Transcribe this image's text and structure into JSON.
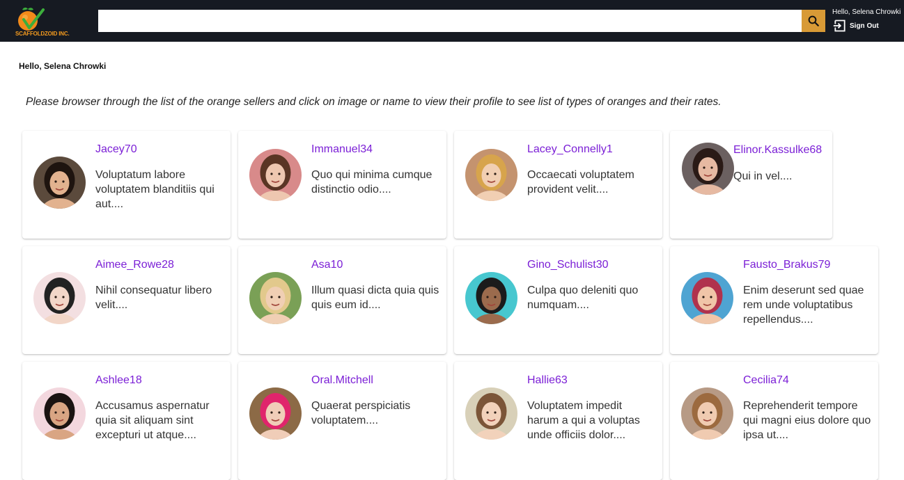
{
  "brand": {
    "logo_text": "SCAFFOLDZOID INC."
  },
  "search": {
    "value": "",
    "placeholder": ""
  },
  "header": {
    "hello": "Hello, Selena Chrowki",
    "signout_label": "Sign Out"
  },
  "main": {
    "greeting": "Hello, Selena Chrowki",
    "instructions": "Please browser through the list of the orange sellers and click on image or name to view their profile to see list of types of oranges and their rates."
  },
  "sellers": [
    {
      "name": "Jacey70",
      "desc": "Voluptatum labore voluptatem blanditiis qui aut....",
      "avatar_bg": "#5b4a3c",
      "skin": "#e2b28f",
      "hair": "#1e140f"
    },
    {
      "name": "Immanuel34",
      "desc": "Quo qui minima cumque distinctio odio....",
      "avatar_bg": "#d88a8a",
      "skin": "#eec7b0",
      "hair": "#5a3524"
    },
    {
      "name": "Lacey_Connelly1",
      "desc": "Occaecati voluptatem provident velit....",
      "avatar_bg": "#c4936f",
      "skin": "#f1cfb3",
      "hair": "#d7a44c"
    },
    {
      "name": "Elinor.Kassulke68",
      "desc": "Qui in vel....",
      "avatar_bg": "#6b6060",
      "skin": "#e6b9a2",
      "hair": "#2a1a16"
    },
    {
      "name": "Aimee_Rowe28",
      "desc": "Nihil consequatur libero velit....",
      "avatar_bg": "#f3dfe1",
      "skin": "#f2d6c8",
      "hair": "#222222"
    },
    {
      "name": "Asa10",
      "desc": "Illum quasi dicta quia quis quis eum id....",
      "avatar_bg": "#7aa056",
      "skin": "#f0cfb4",
      "hair": "#e2c98c"
    },
    {
      "name": "Gino_Schulist30",
      "desc": "Culpa quo deleniti quo numquam....",
      "avatar_bg": "#47c7cf",
      "skin": "#9b6b4d",
      "hair": "#1b1b1b"
    },
    {
      "name": "Fausto_Brakus79",
      "desc": "Enim deserunt sed quae rem unde voluptatibus repellendus....",
      "avatar_bg": "#4fa4d2",
      "skin": "#f0c5a8",
      "hair": "#b0324d"
    },
    {
      "name": "Ashlee18",
      "desc": "Accusamus aspernatur quia sit aliquam sint excepturi ut atque....",
      "avatar_bg": "#f3d7de",
      "skin": "#d9a583",
      "hair": "#1a1311"
    },
    {
      "name": "Oral.Mitchell",
      "desc": "Quaerat perspiciatis voluptatem....",
      "avatar_bg": "#8c6a46",
      "skin": "#f0cdb8",
      "hair": "#e0246c"
    },
    {
      "name": "Hallie63",
      "desc": "Voluptatem impedit harum a qui a voluptas unde officiis dolor....",
      "avatar_bg": "#d8d0b8",
      "skin": "#f2d2bb",
      "hair": "#7b5538"
    },
    {
      "name": "Cecilia74",
      "desc": "Reprehenderit tempore qui magni eius dolore quo ipsa ut....",
      "avatar_bg": "#b79a85",
      "skin": "#f0cbb1",
      "hair": "#9c6a3f"
    }
  ],
  "colors": {
    "topbar": "#161a22",
    "search_button": "#d89a36",
    "link": "#7b1fd6"
  },
  "icons": {
    "search": "search-icon",
    "signout": "sign-out-icon",
    "logo": "orange-logo-icon"
  }
}
